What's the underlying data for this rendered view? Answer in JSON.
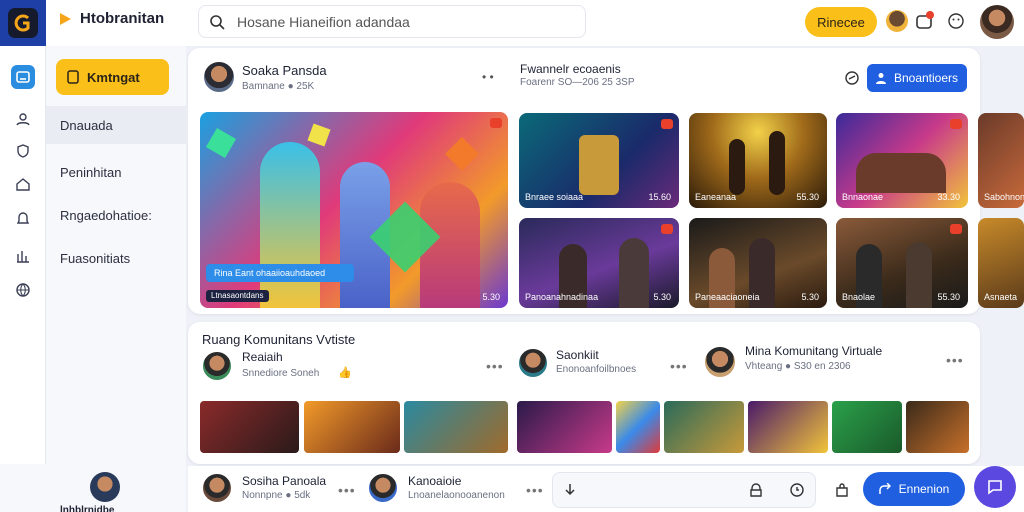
{
  "app": {
    "title": "Htobranitan",
    "accent": "#fbbf1a",
    "brand_blue": "#1f5fe0"
  },
  "search": {
    "placeholder": "Hosane Hianeifion adandaa"
  },
  "topbar": {
    "action_label": "Rinecee"
  },
  "sidebar": {
    "primary_label": "Kmtngat",
    "items": [
      {
        "label": "Dnauada"
      },
      {
        "label": "Peninhitan"
      },
      {
        "label": "Rngaedohatioe:"
      },
      {
        "label": "Fuasonitiats"
      }
    ],
    "footer_name": "lnhblrnidbe"
  },
  "creator": {
    "name": "Soaka Pansda",
    "meta": "Bamnane ● 25K",
    "event_title": "Fwannelr ecoaenis",
    "event_meta": "Foarenr SO—206 25 3SP",
    "cta_label": "Bnoantioers"
  },
  "featured": {
    "caption": "Rina Eant ohaaiioauhdaoed",
    "tag": "Ltnasaontdans",
    "price": "5.30"
  },
  "grid": [
    {
      "caption": "Bnraee soiaaa",
      "price": "15.60"
    },
    {
      "caption": "Eaneanaa",
      "price": "55.30"
    },
    {
      "caption": "Bnnaonae",
      "price": "33.30"
    },
    {
      "caption": "Sabohnonate",
      "price": ""
    },
    {
      "caption": "Panoanahnadinaa",
      "price": "5.30"
    },
    {
      "caption": "Paneaaciaoneia",
      "price": "5.30"
    },
    {
      "caption": "Bnaolae",
      "price": "55.30"
    },
    {
      "caption": "Asnaeta",
      "price": ""
    }
  ],
  "community": {
    "title": "Ruang Komunitans Vvtiste",
    "members": [
      {
        "name": "Reaiaih",
        "meta": "Snnediore Soneh"
      },
      {
        "name": "Saonkiit",
        "meta": "Enonoanfoilbnoes"
      },
      {
        "name": "Mina Komunitang Virtuale",
        "meta": "Vhteang ● S30 en 2306"
      }
    ]
  },
  "footer_bar": {
    "user1": {
      "name": "Sosiha Panoala",
      "meta": "Nonnpne ● 5dk"
    },
    "user2": {
      "name": "Kanoaioie",
      "meta": "Lnoanelaonooanenon"
    },
    "cta_label": "Ennenion"
  }
}
